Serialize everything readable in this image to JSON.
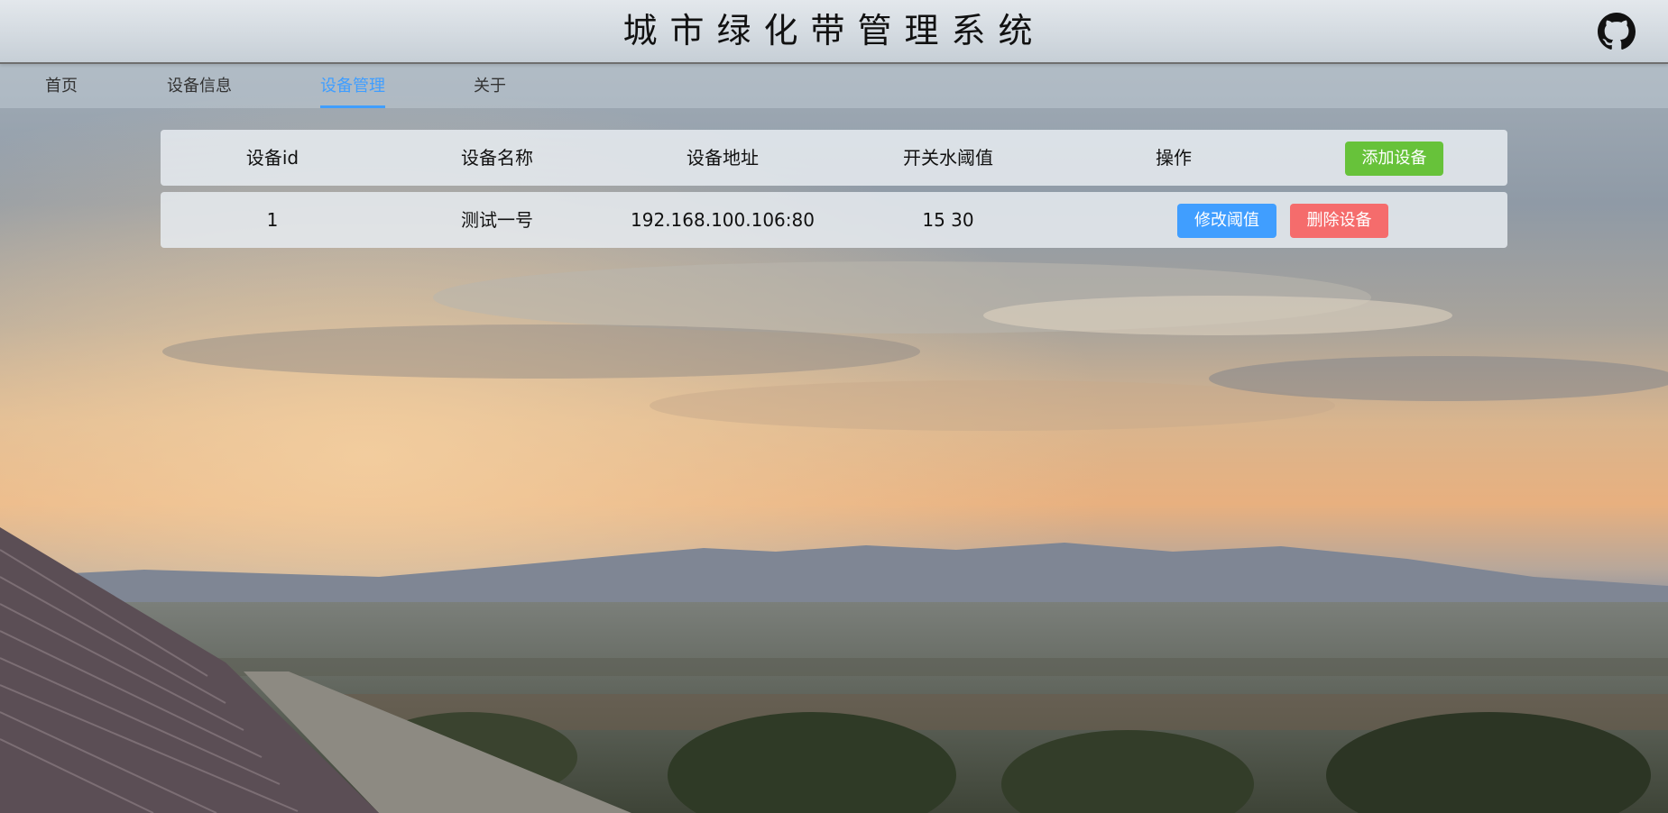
{
  "header": {
    "title": "城市绿化带管理系统",
    "github_icon": "github-icon"
  },
  "nav": {
    "items": [
      {
        "label": "首页"
      },
      {
        "label": "设备信息"
      },
      {
        "label": "设备管理",
        "active": true
      },
      {
        "label": "关于"
      }
    ]
  },
  "table": {
    "columns": [
      "设备id",
      "设备名称",
      "设备地址",
      "开关水阈值",
      "操作"
    ],
    "add_button": "添加设备",
    "rows": [
      {
        "id": "1",
        "name": "测试一号",
        "address": "192.168.100.106:80",
        "threshold": "15 30",
        "edit_button": "修改阈值",
        "delete_button": "删除设备"
      }
    ]
  },
  "colors": {
    "accent": "#409eff",
    "success": "#67c23a",
    "danger": "#f56c6c"
  }
}
